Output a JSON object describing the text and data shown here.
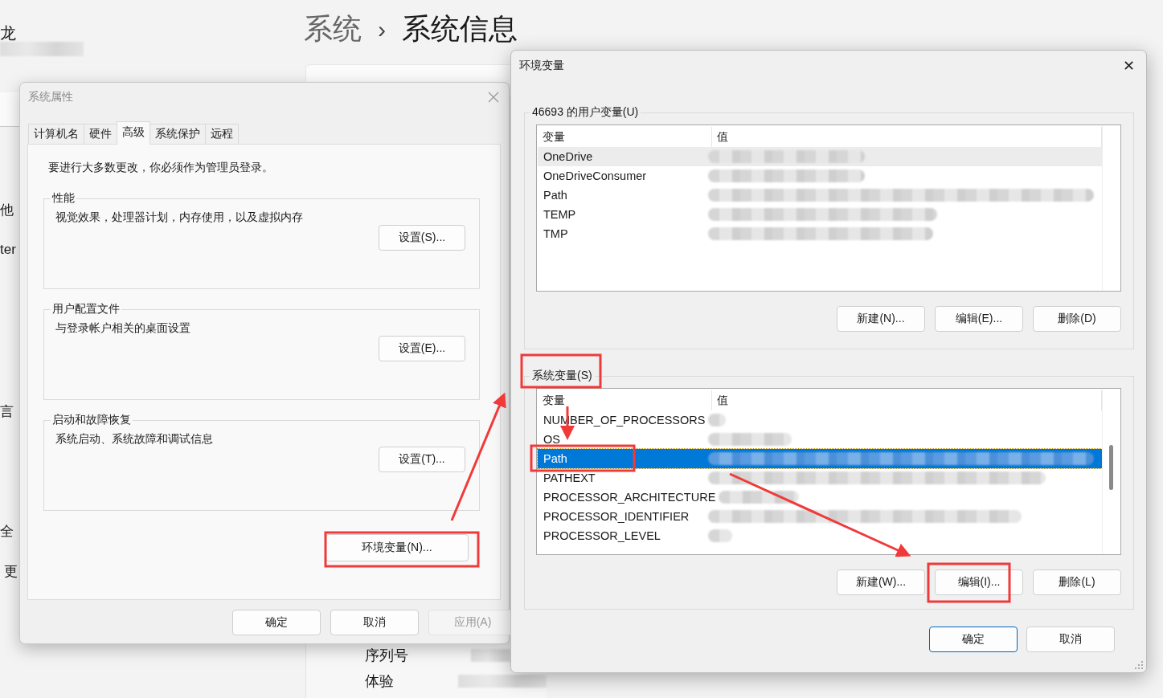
{
  "background_page": {
    "user_name": "龙",
    "breadcrumb": {
      "parent": "系统",
      "separator": "›",
      "current": "系统信息"
    },
    "side_texts": [
      "他",
      "ter",
      "言",
      "全",
      "更"
    ],
    "info_labels": [
      "序列号",
      "体验"
    ]
  },
  "system_properties": {
    "title": "系统属性",
    "active": false,
    "tabs": [
      {
        "label": "计算机名",
        "selected": false
      },
      {
        "label": "硬件",
        "selected": false
      },
      {
        "label": "高级",
        "selected": true
      },
      {
        "label": "系统保护",
        "selected": false
      },
      {
        "label": "远程",
        "selected": false
      }
    ],
    "notice": "要进行大多数更改，你必须作为管理员登录。",
    "groups": [
      {
        "title": "性能",
        "description": "视觉效果，处理器计划，内存使用，以及虚拟内存",
        "button": "设置(S)..."
      },
      {
        "title": "用户配置文件",
        "description": "与登录帐户相关的桌面设置",
        "button": "设置(E)..."
      },
      {
        "title": "启动和故障恢复",
        "description": "系统启动、系统故障和调试信息",
        "button": "设置(T)..."
      }
    ],
    "env_button": "环境变量(N)...",
    "buttons": [
      {
        "label": "确定",
        "disabled": false
      },
      {
        "label": "取消",
        "disabled": false
      },
      {
        "label": "应用(A)",
        "disabled": true
      }
    ]
  },
  "environment_variables": {
    "title": "环境变量",
    "close": "✕",
    "lists": [
      {
        "title": "46693 的用户变量(U)",
        "focused": false,
        "columns": [
          "变量",
          "值"
        ],
        "rows": [
          {
            "name": "OneDrive",
            "selected": true
          },
          {
            "name": "OneDriveConsumer",
            "selected": false
          },
          {
            "name": "Path",
            "selected": false
          },
          {
            "name": "TEMP",
            "selected": false
          },
          {
            "name": "TMP",
            "selected": false
          }
        ],
        "buttons": [
          "新建(N)...",
          "编辑(E)...",
          "删除(D)"
        ]
      },
      {
        "title": "系统变量(S)",
        "focused": true,
        "columns": [
          "变量",
          "值"
        ],
        "rows": [
          {
            "name": "NUMBER_OF_PROCESSORS",
            "selected": false
          },
          {
            "name": "OS",
            "selected": false
          },
          {
            "name": "Path",
            "selected": true
          },
          {
            "name": "PATHEXT",
            "selected": false
          },
          {
            "name": "PROCESSOR_ARCHITECTURE",
            "selected": false
          },
          {
            "name": "PROCESSOR_IDENTIFIER",
            "selected": false
          },
          {
            "name": "PROCESSOR_LEVEL",
            "selected": false
          }
        ],
        "buttons": [
          "新建(W)...",
          "编辑(I)...",
          "删除(L)"
        ]
      }
    ],
    "buttons": [
      {
        "label": "确定",
        "default": true
      },
      {
        "label": "取消",
        "default": false
      }
    ]
  }
}
